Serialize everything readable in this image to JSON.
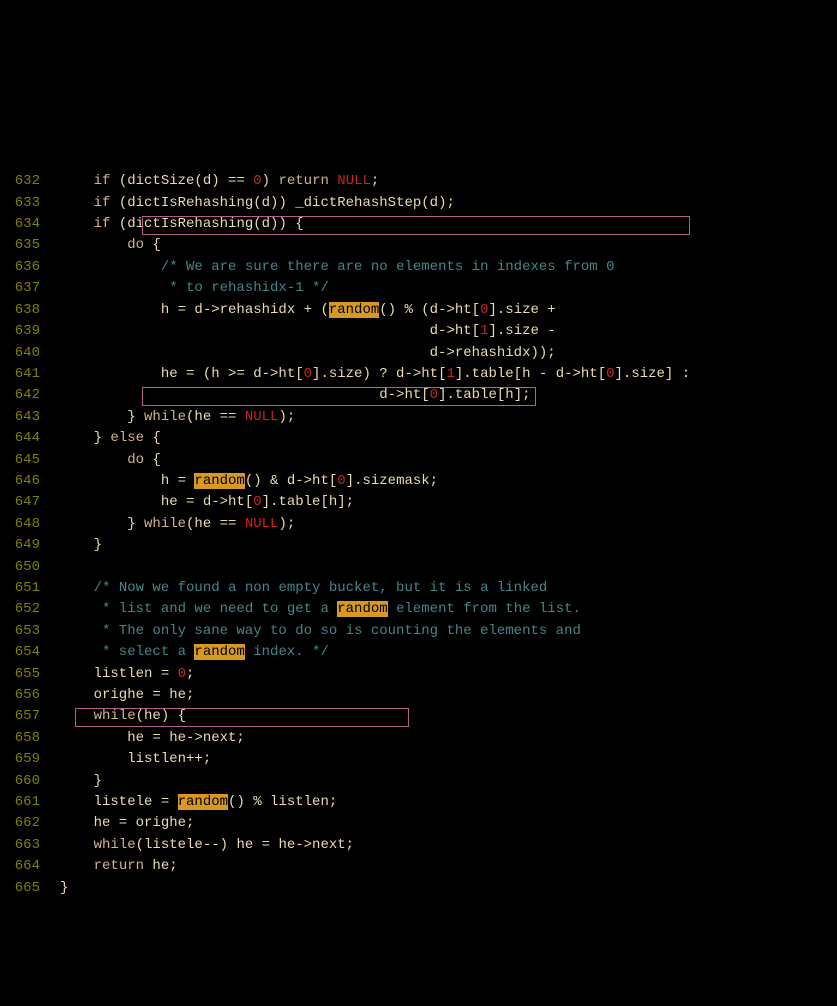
{
  "lines": {
    "632": {
      "n": "632",
      "parts": [
        {
          "c": "    ",
          "t": "plain"
        },
        {
          "c": "if",
          "t": "kw"
        },
        {
          "c": " (dictSize(d) == ",
          "t": "plain"
        },
        {
          "c": "0",
          "t": "num"
        },
        {
          "c": ") ",
          "t": "plain"
        },
        {
          "c": "return",
          "t": "kw"
        },
        {
          "c": " ",
          "t": "plain"
        },
        {
          "c": "NULL",
          "t": "null"
        },
        {
          "c": ";",
          "t": "plain"
        }
      ]
    },
    "633": {
      "n": "633",
      "parts": [
        {
          "c": "    ",
          "t": "plain"
        },
        {
          "c": "if",
          "t": "kw"
        },
        {
          "c": " (dictIsRehashing(d)) _dictRehashStep(d);",
          "t": "plain"
        }
      ]
    },
    "634": {
      "n": "634",
      "parts": [
        {
          "c": "    ",
          "t": "plain"
        },
        {
          "c": "if",
          "t": "kw"
        },
        {
          "c": " (dictIsRehashing(d)) {",
          "t": "plain"
        }
      ]
    },
    "635": {
      "n": "635",
      "parts": [
        {
          "c": "        ",
          "t": "plain"
        },
        {
          "c": "do",
          "t": "kw"
        },
        {
          "c": " {",
          "t": "plain"
        }
      ]
    },
    "636": {
      "n": "636",
      "parts": [
        {
          "c": "            ",
          "t": "plain"
        },
        {
          "c": "/* We are sure there are no elements in indexes from 0",
          "t": "cmt"
        }
      ]
    },
    "637": {
      "n": "637",
      "parts": [
        {
          "c": "             * to rehashidx-1 */",
          "t": "cmt"
        }
      ]
    },
    "638": {
      "n": "638",
      "parts": [
        {
          "c": "            h = d->rehashidx + (",
          "t": "plain"
        },
        {
          "c": "random",
          "t": "hl"
        },
        {
          "c": "() % (d->ht[",
          "t": "plain"
        },
        {
          "c": "0",
          "t": "num"
        },
        {
          "c": "].size +",
          "t": "plain"
        }
      ]
    },
    "639": {
      "n": "639",
      "parts": [
        {
          "c": "                                            d->ht[",
          "t": "plain"
        },
        {
          "c": "1",
          "t": "num"
        },
        {
          "c": "].size -",
          "t": "plain"
        }
      ]
    },
    "640": {
      "n": "640",
      "parts": [
        {
          "c": "                                            d->rehashidx));",
          "t": "plain"
        }
      ]
    },
    "641": {
      "n": "641",
      "parts": [
        {
          "c": "            he = (h >= d->ht[",
          "t": "plain"
        },
        {
          "c": "0",
          "t": "num"
        },
        {
          "c": "].size) ? d->ht[",
          "t": "plain"
        },
        {
          "c": "1",
          "t": "num"
        },
        {
          "c": "].table[h - d->ht[",
          "t": "plain"
        },
        {
          "c": "0",
          "t": "num"
        },
        {
          "c": "].size] :",
          "t": "plain"
        }
      ]
    },
    "642": {
      "n": "642",
      "parts": [
        {
          "c": "                                      d->ht[",
          "t": "plain"
        },
        {
          "c": "0",
          "t": "num"
        },
        {
          "c": "].table[h];",
          "t": "plain"
        }
      ]
    },
    "643": {
      "n": "643",
      "parts": [
        {
          "c": "        } ",
          "t": "plain"
        },
        {
          "c": "while",
          "t": "kw"
        },
        {
          "c": "(he == ",
          "t": "plain"
        },
        {
          "c": "NULL",
          "t": "null"
        },
        {
          "c": ");",
          "t": "plain"
        }
      ]
    },
    "644": {
      "n": "644",
      "parts": [
        {
          "c": "    } ",
          "t": "plain"
        },
        {
          "c": "else",
          "t": "kw"
        },
        {
          "c": " {",
          "t": "plain"
        }
      ]
    },
    "645": {
      "n": "645",
      "parts": [
        {
          "c": "        ",
          "t": "plain"
        },
        {
          "c": "do",
          "t": "kw"
        },
        {
          "c": " {",
          "t": "plain"
        }
      ]
    },
    "646": {
      "n": "646",
      "parts": [
        {
          "c": "            h = ",
          "t": "plain"
        },
        {
          "c": "random",
          "t": "hl"
        },
        {
          "c": "() & d->ht[",
          "t": "plain"
        },
        {
          "c": "0",
          "t": "num"
        },
        {
          "c": "].sizemask;",
          "t": "plain"
        }
      ]
    },
    "647": {
      "n": "647",
      "parts": [
        {
          "c": "            he = d->ht[",
          "t": "plain"
        },
        {
          "c": "0",
          "t": "num"
        },
        {
          "c": "].table[h];",
          "t": "plain"
        }
      ]
    },
    "648": {
      "n": "648",
      "parts": [
        {
          "c": "        } ",
          "t": "plain"
        },
        {
          "c": "while",
          "t": "kw"
        },
        {
          "c": "(he == ",
          "t": "plain"
        },
        {
          "c": "NULL",
          "t": "null"
        },
        {
          "c": ");",
          "t": "plain"
        }
      ]
    },
    "649": {
      "n": "649",
      "parts": [
        {
          "c": "    }",
          "t": "plain"
        }
      ]
    },
    "650": {
      "n": "650",
      "parts": [
        {
          "c": "",
          "t": "plain"
        }
      ]
    },
    "651": {
      "n": "651",
      "parts": [
        {
          "c": "    ",
          "t": "plain"
        },
        {
          "c": "/* Now we found a non empty bucket, but it is a linked",
          "t": "cmt"
        }
      ]
    },
    "652": {
      "n": "652",
      "parts": [
        {
          "c": "     * list and we need to get a ",
          "t": "cmt"
        },
        {
          "c": "random",
          "t": "hl"
        },
        {
          "c": " element from the list.",
          "t": "cmt"
        }
      ]
    },
    "653": {
      "n": "653",
      "parts": [
        {
          "c": "     * The only sane way to do so is counting the elements and",
          "t": "cmt"
        }
      ]
    },
    "654": {
      "n": "654",
      "parts": [
        {
          "c": "     * select a ",
          "t": "cmt"
        },
        {
          "c": "random",
          "t": "hl"
        },
        {
          "c": " index. */",
          "t": "cmt"
        }
      ]
    },
    "655": {
      "n": "655",
      "parts": [
        {
          "c": "    listlen = ",
          "t": "plain"
        },
        {
          "c": "0",
          "t": "num"
        },
        {
          "c": ";",
          "t": "plain"
        }
      ]
    },
    "656": {
      "n": "656",
      "parts": [
        {
          "c": "    orighe = he;",
          "t": "plain"
        }
      ]
    },
    "657": {
      "n": "657",
      "parts": [
        {
          "c": "    ",
          "t": "plain"
        },
        {
          "c": "while",
          "t": "kw"
        },
        {
          "c": "(he) {",
          "t": "plain"
        }
      ]
    },
    "658": {
      "n": "658",
      "parts": [
        {
          "c": "        he = he->next;",
          "t": "plain"
        }
      ]
    },
    "659": {
      "n": "659",
      "parts": [
        {
          "c": "        listlen++;",
          "t": "plain"
        }
      ]
    },
    "660": {
      "n": "660",
      "parts": [
        {
          "c": "    }",
          "t": "plain"
        }
      ]
    },
    "661": {
      "n": "661",
      "parts": [
        {
          "c": "    listele = ",
          "t": "plain"
        },
        {
          "c": "random",
          "t": "hl"
        },
        {
          "c": "() % listlen;",
          "t": "plain"
        }
      ]
    },
    "662": {
      "n": "662",
      "parts": [
        {
          "c": "    he = orighe;",
          "t": "plain"
        }
      ]
    },
    "663": {
      "n": "663",
      "parts": [
        {
          "c": "    ",
          "t": "plain"
        },
        {
          "c": "while",
          "t": "kw"
        },
        {
          "c": "(listele--) he = he->next;",
          "t": "plain"
        }
      ]
    },
    "664": {
      "n": "664",
      "parts": [
        {
          "c": "    ",
          "t": "plain"
        },
        {
          "c": "return",
          "t": "kw"
        },
        {
          "c": " he;",
          "t": "plain"
        }
      ]
    },
    "665": {
      "n": "665",
      "parts": [
        {
          "c": "}",
          "t": "plain"
        }
      ]
    }
  },
  "lineOrder": [
    "632",
    "633",
    "634",
    "635",
    "636",
    "637",
    "638",
    "639",
    "640",
    "641",
    "642",
    "643",
    "644",
    "645",
    "646",
    "647",
    "648",
    "649",
    "650",
    "651",
    "652",
    "653",
    "654",
    "655",
    "656",
    "657",
    "658",
    "659",
    "660",
    "661",
    "662",
    "663",
    "664",
    "665"
  ]
}
